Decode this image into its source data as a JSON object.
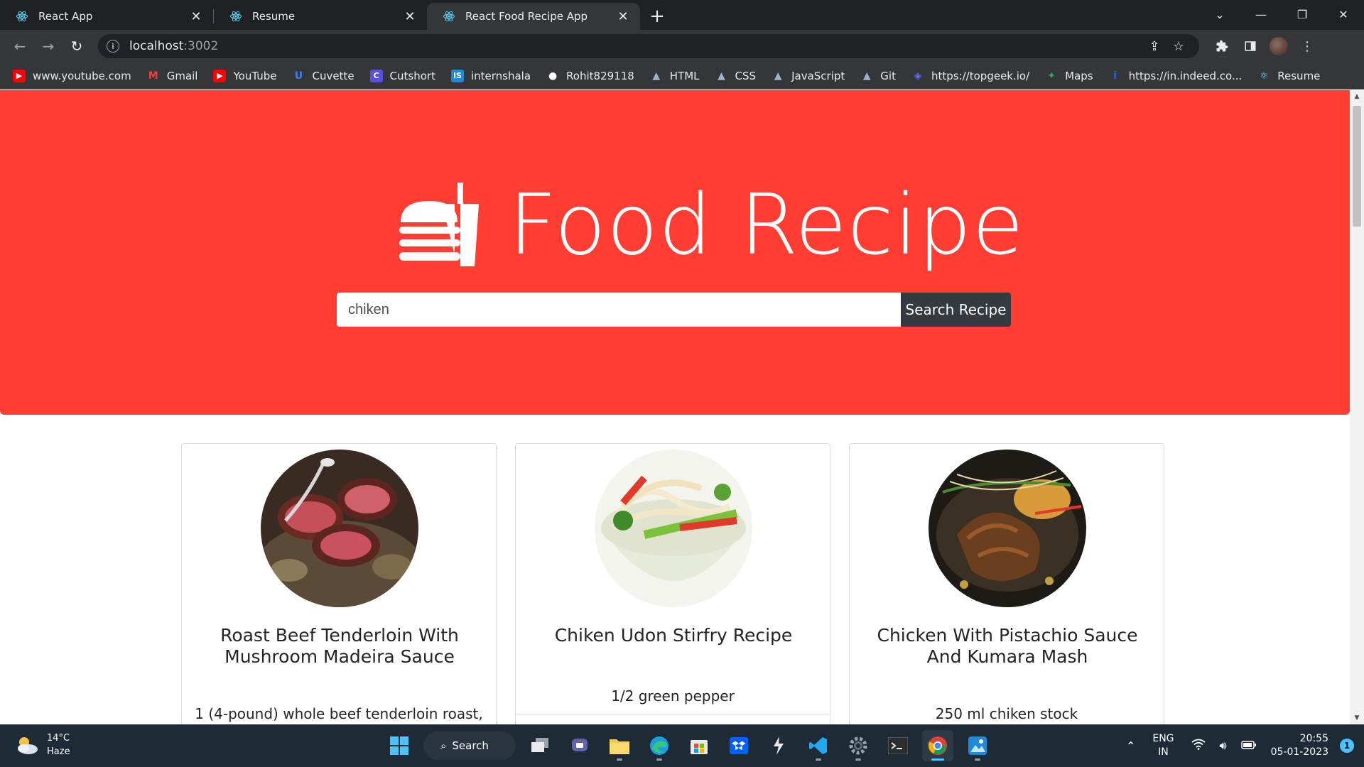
{
  "browser": {
    "tabs": [
      {
        "title": "React App",
        "active": false
      },
      {
        "title": "Resume",
        "active": false
      },
      {
        "title": "React Food Recipe App",
        "active": true
      }
    ],
    "address": {
      "host": "localhost",
      "port": ":3002"
    },
    "bookmarks": [
      {
        "label": "www.youtube.com",
        "icon": "youtube-icon",
        "color": "#ff0000"
      },
      {
        "label": "Gmail",
        "icon": "gmail-icon",
        "color": "#ea4335"
      },
      {
        "label": "YouTube",
        "icon": "youtube-icon",
        "color": "#ff0000"
      },
      {
        "label": "Cuvette",
        "icon": "cuvette-icon",
        "color": "#3b82f6"
      },
      {
        "label": "Cutshort",
        "icon": "cutshort-icon",
        "color": "#5b4fe0"
      },
      {
        "label": "internshala",
        "icon": "internshala-icon",
        "color": "#1a8cd8"
      },
      {
        "label": "Rohit829118",
        "icon": "github-icon",
        "color": "#ffffff"
      },
      {
        "label": "HTML",
        "icon": "mountain-icon",
        "color": "#9fb3c8"
      },
      {
        "label": "CSS",
        "icon": "mountain-icon",
        "color": "#9fb3c8"
      },
      {
        "label": "JavaScript",
        "icon": "mountain-icon",
        "color": "#9fb3c8"
      },
      {
        "label": "Git",
        "icon": "mountain-icon",
        "color": "#9fb3c8"
      },
      {
        "label": "https://topgeek.io/",
        "icon": "topgeek-icon",
        "color": "#5b6cff"
      },
      {
        "label": "Maps",
        "icon": "maps-icon",
        "color": "#34a853"
      },
      {
        "label": "https://in.indeed.co...",
        "icon": "indeed-icon",
        "color": "#2164f3"
      },
      {
        "label": "Resume",
        "icon": "react-icon",
        "color": "#61dafb"
      }
    ]
  },
  "app": {
    "brand_title": "Food Recipe",
    "accent": "#ff3d33",
    "search": {
      "value": "chiken",
      "button_label": "Search Recipe"
    },
    "recipes": [
      {
        "title": "Roast Beef Tenderloin With Mushroom Madeira Sauce",
        "ingredient": "1 (4-pound) whole beef tenderloin roast,",
        "image": "roast-beef-photo"
      },
      {
        "title": "Chiken Udon Stirfry Recipe",
        "ingredient": "1/2 green pepper",
        "image": "udon-stirfry-photo"
      },
      {
        "title": "Chicken With Pistachio Sauce And Kumara Mash",
        "ingredient": "250 ml chiken stock",
        "image": "chicken-pistachio-photo"
      }
    ]
  },
  "taskbar": {
    "weather": {
      "temp": "14°C",
      "condition": "Haze"
    },
    "search_label": "Search",
    "lang": {
      "line1": "ENG",
      "line2": "IN"
    },
    "time": "20:55",
    "date": "05-01-2023",
    "notification_count": "1"
  }
}
